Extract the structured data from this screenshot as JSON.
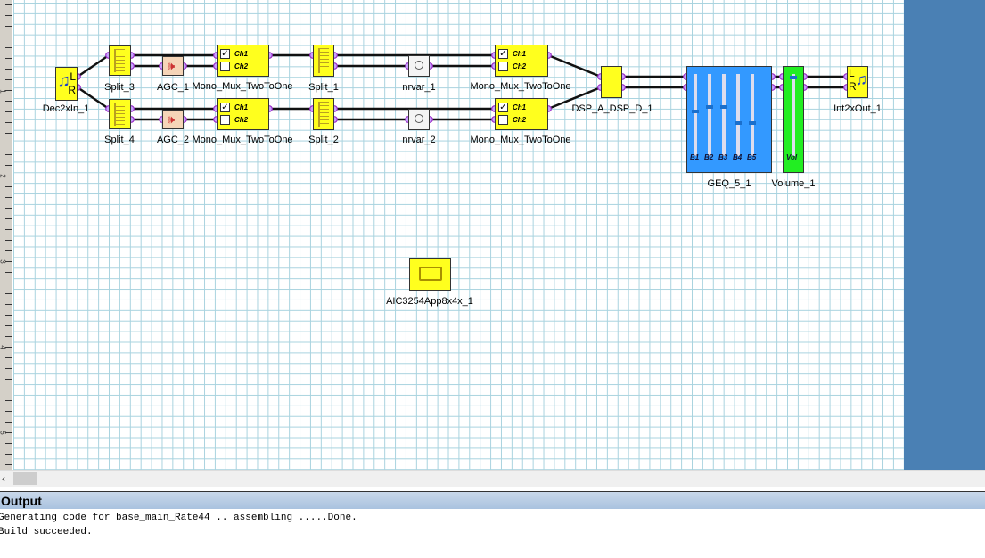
{
  "ruler": {
    "marks": [
      "1",
      "2",
      "3",
      "4",
      "5"
    ]
  },
  "blocks": {
    "dec2xin": "Dec2xIn_1",
    "split3": "Split_3",
    "split4": "Split_4",
    "agc1": "AGC_1",
    "agc2": "AGC_2",
    "mux1": "Mono_Mux_TwoToOne",
    "mux2": "Mono_Mux_TwoToOne",
    "split1": "Split_1",
    "split2": "Split_2",
    "nrvar1": "nrvar_1",
    "nrvar2": "nrvar_2",
    "mux3": "Mono_Mux_TwoToOne",
    "mux4": "Mono_Mux_TwoToOne",
    "dsp": "DSP_A_DSP_D_1",
    "geq": "GEQ_5_1",
    "volume": "Volume_1",
    "int2xout": "Int2xOut_1",
    "aic": "AIC3254App8x4x_1"
  },
  "mux": {
    "ch1": "Ch1",
    "ch2": "Ch2",
    "ch1_checked": true,
    "ch2_checked": false
  },
  "geq": {
    "bands": [
      "B1",
      "B2",
      "B3",
      "B4",
      "B5"
    ],
    "levels": [
      0.55,
      0.6,
      0.6,
      0.4,
      0.4
    ]
  },
  "volume": {
    "label": "Vol",
    "level": 0.98
  },
  "io": {
    "l": "L",
    "r": "R"
  },
  "output": {
    "title": "Output",
    "lines": [
      "Generating code for base_main_Rate44 ..  assembling .....Done.",
      "Build succeeded."
    ]
  },
  "colors": {
    "block": "#ffff1e",
    "geq": "#3399ff",
    "volume": "#22ee22",
    "port": "#b84dd6",
    "panel": "#4a80b4"
  }
}
